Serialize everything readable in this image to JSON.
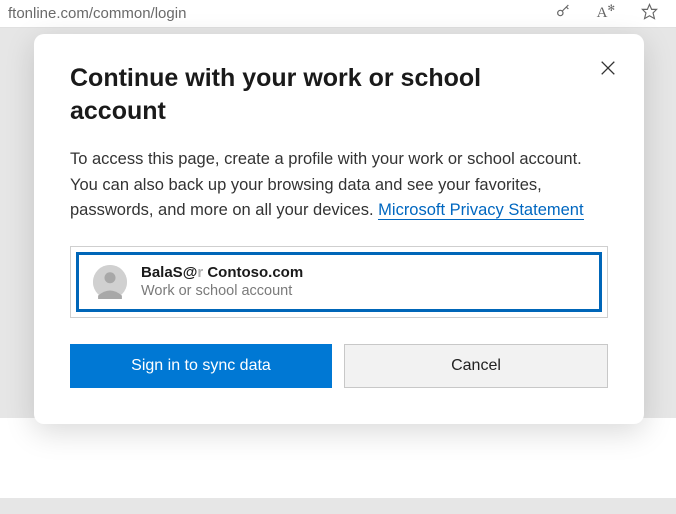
{
  "addressBar": {
    "urlFragment": "ftonline.com/common/login"
  },
  "dialog": {
    "title": "Continue with your work or school account",
    "bodyText": "To access this page, create a profile with your work or school account. You can also back up your browsing data and see your favorites, passwords, and more on all your devices. ",
    "privacyLinkText": "Microsoft Privacy Statement",
    "account": {
      "emailPrefix": "BalaS@",
      "emailFaded": "r",
      "emailDomain": " Contoso.com",
      "type": "Work or school account"
    },
    "buttons": {
      "primary": "Sign in to sync data",
      "secondary": "Cancel"
    }
  }
}
